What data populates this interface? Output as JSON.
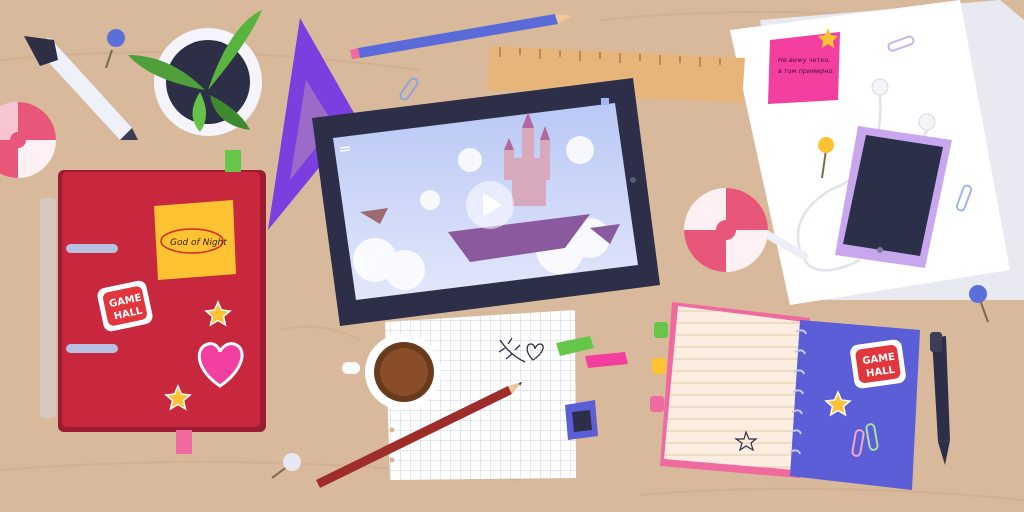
{
  "scene": {
    "description_free": true
  },
  "folder": {
    "sticky_note_text": "God of Night",
    "sticker_text_line1": "GAME",
    "sticker_text_line2": "HALL"
  },
  "notebook": {
    "sticker_text_line1": "GAME",
    "sticker_text_line2": "HALL"
  },
  "pink_note": {
    "text_line1": "Не вижу четко,",
    "text_line2": "в том примерно."
  },
  "colors": {
    "desk": "#d9b99b",
    "folder": "#c7283e",
    "tablet_frame": "#2c2f47",
    "notebook_cover": "#5b5ed6",
    "sticky_yellow": "#ffc233",
    "sticky_pink": "#f23fa0",
    "triangle": "#7b3fe0"
  }
}
